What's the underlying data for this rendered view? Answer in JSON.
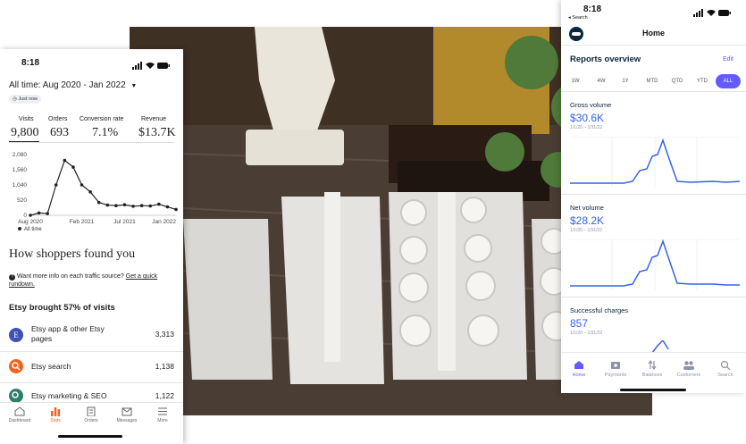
{
  "left_phone": {
    "time": "8:18",
    "date_range": "All time: Aug 2020 - Jan 2022",
    "badge": "Just now",
    "metrics": [
      {
        "label": "Visits",
        "value": "9,800"
      },
      {
        "label": "Orders",
        "value": "693"
      },
      {
        "label": "Conversion rate",
        "value": "7.1%"
      },
      {
        "label": "Revenue",
        "value": "$13.7K"
      }
    ],
    "chart_y_ticks": [
      "2,080",
      "1,560",
      "1,040",
      "520",
      "0"
    ],
    "chart_x_ticks": [
      "Aug 2020",
      "Feb 2021",
      "Jul 2021",
      "Jan 2022"
    ],
    "legend": "All time",
    "section_title": "How shoppers found you",
    "info_text": "Want more info on each traffic source?",
    "info_link": "Get a quick rundown.",
    "subheading": "Etsy brought 57% of visits",
    "sources": [
      {
        "label": "Etsy app & other Etsy pages",
        "value": "3,313",
        "avatar": "E"
      },
      {
        "label": "Etsy search",
        "value": "1,138"
      },
      {
        "label": "Etsy marketing & SEO",
        "value": "1,122"
      }
    ],
    "tabs": [
      "Dashboard",
      "Stats",
      "Orders",
      "Messages",
      "More"
    ],
    "accent": "#f1641e"
  },
  "right_phone": {
    "time": "8:18",
    "back": "Search",
    "title": "Home",
    "section": "Reports overview",
    "edit": "Edit",
    "ranges": [
      "1W",
      "4W",
      "1Y",
      "MTD",
      "QTD",
      "YTD",
      "ALL"
    ],
    "cards": [
      {
        "title": "Gross volume",
        "value": "$30.6K",
        "date": "1/1/20 – 1/31/22"
      },
      {
        "title": "Net volume",
        "value": "$28.2K",
        "date": "1/1/20 – 1/31/22"
      },
      {
        "title": "Successful charges",
        "value": "857",
        "date": "1/1/20 – 1/31/22"
      }
    ],
    "tabs": [
      "Home",
      "Payments",
      "Balances",
      "Customers",
      "Search"
    ],
    "accent": "#635bff"
  },
  "chart_data": {
    "type": "line",
    "x": [
      "Aug 2020",
      "Sep 2020",
      "Oct 2020",
      "Nov 2020",
      "Dec 2020",
      "Jan 2021",
      "Feb 2021",
      "Mar 2021",
      "Apr 2021",
      "May 2021",
      "Jun 2021",
      "Jul 2021",
      "Aug 2021",
      "Sep 2021",
      "Oct 2021",
      "Nov 2021",
      "Dec 2021",
      "Jan 2022"
    ],
    "series": [
      {
        "values": [
          0,
          80,
          60,
          1040,
          1880,
          1650,
          1040,
          800,
          440,
          350,
          330,
          360,
          310,
          330,
          320,
          380,
          290,
          200
        ]
      }
    ],
    "ylim": [
      0,
      2080
    ],
    "yticks": [
      0,
      520,
      1040,
      1560,
      2080
    ],
    "legend": "bottom-left",
    "grid": false
  }
}
